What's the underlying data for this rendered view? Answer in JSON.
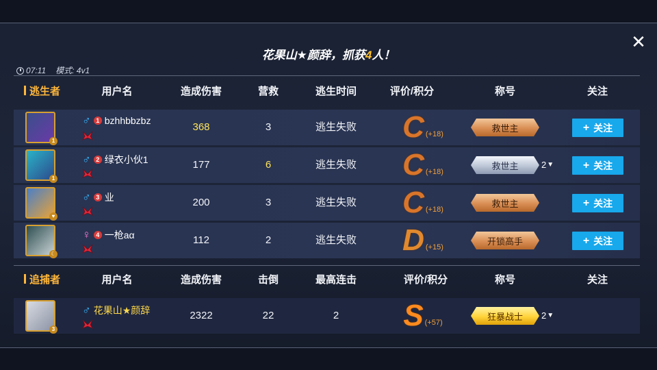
{
  "header": {
    "headline_prefix": "花果山★颜辞，抓获",
    "headline_num": "4",
    "headline_suffix": "人！",
    "time": "07:11",
    "mode": "模式: 4v1"
  },
  "escapee_columns": {
    "team": "逃生者",
    "user": "用户名",
    "damage": "造成伤害",
    "rescue": "营救",
    "escape_time": "逃生时间",
    "rating": "评价/积分",
    "title": "称号",
    "follow": "关注"
  },
  "escapees": [
    {
      "rank": "1",
      "gender": "♂",
      "name": "bzhhbbzbz",
      "damage": "368",
      "rescue": "3",
      "escape_time": "逃生失败",
      "grade": "C",
      "points": "(+18)",
      "title": "救世主",
      "title_count": "",
      "follow": "关注"
    },
    {
      "rank": "2",
      "gender": "♂",
      "name": "绿衣小伙1",
      "damage": "177",
      "rescue": "6",
      "escape_time": "逃生失败",
      "grade": "C",
      "points": "(+18)",
      "title": "救世主",
      "title_count": "2",
      "follow": "关注"
    },
    {
      "rank": "3",
      "gender": "♂",
      "name": "业",
      "damage": "200",
      "rescue": "3",
      "escape_time": "逃生失败",
      "grade": "C",
      "points": "(+18)",
      "title": "救世主",
      "title_count": "",
      "follow": "关注"
    },
    {
      "rank": "4",
      "gender": "♀",
      "name": "一枪aα",
      "damage": "112",
      "rescue": "2",
      "escape_time": "逃生失败",
      "grade": "D",
      "points": "(+15)",
      "title": "开锁高手",
      "title_count": "",
      "follow": "关注"
    }
  ],
  "hunter_columns": {
    "team": "追捕者",
    "user": "用户名",
    "damage": "造成伤害",
    "knockdown": "击倒",
    "combo": "最高连击",
    "rating": "评价/积分",
    "title": "称号",
    "follow": "关注"
  },
  "hunter": {
    "gender": "♂",
    "name": "花果山★颜辞",
    "damage": "2322",
    "knockdown": "22",
    "combo": "2",
    "grade": "S",
    "points": "(+57)",
    "title": "狂暴战士",
    "title_count": "2"
  },
  "icons": {
    "close": "close-icon",
    "clock": "clock-icon",
    "caret": "caret-down-icon",
    "plus": "plus-icon"
  },
  "colors": {
    "accent_orange": "#ffb73a",
    "follow_blue": "#18a8ec",
    "highlight_yellow": "#ffe45a",
    "male_blue": "#39b7ff",
    "female_pink": "#ff76d2"
  }
}
